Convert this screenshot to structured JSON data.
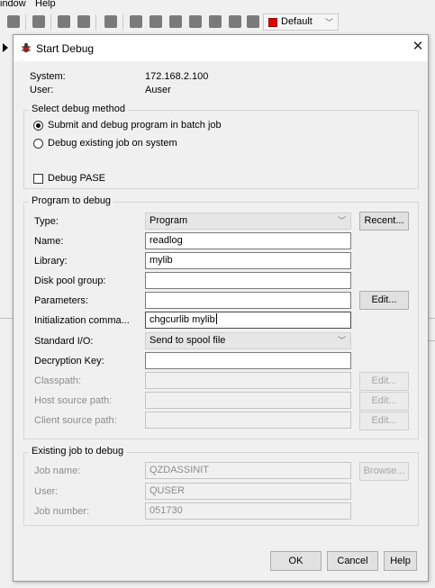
{
  "app": {
    "menu": [
      "indow",
      "Help"
    ],
    "toolbar_combo": "Default"
  },
  "dialog": {
    "title": "Start Debug",
    "close_glyph": "✕",
    "system_label": "System:",
    "system_value": "172.168.2.100",
    "user_label": "User:",
    "user_value": "Auser",
    "method_group": {
      "title": "Select debug method",
      "option_batch": "Submit and debug program in batch job",
      "option_existing": "Debug existing job on system",
      "pase_label": "Debug PASE",
      "selected": "batch",
      "pase_checked": false
    },
    "program_group": {
      "title": "Program to debug",
      "type_label": "Type:",
      "type_value": "Program",
      "recent_button": "Recent...",
      "name_label": "Name:",
      "name_value": "readlog",
      "library_label": "Library:",
      "library_value": "mylib",
      "disk_pool_label": "Disk pool group:",
      "disk_pool_value": "",
      "parameters_label": "Parameters:",
      "parameters_value": "",
      "edit_button": "Edit...",
      "init_cmd_label": "Initialization comma...",
      "init_cmd_value": "chgcurlib mylib",
      "stdio_label": "Standard I/O:",
      "stdio_value": "Send to spool file",
      "decryption_label": "Decryption Key:",
      "decryption_value": "",
      "classpath_label": "Classpath:",
      "host_source_label": "Host source path:",
      "client_source_label": "Client source path:"
    },
    "existing_group": {
      "title": "Existing job to debug",
      "job_name_label": "Job name:",
      "job_name_value": "QZDASSINIT",
      "browse_button": "Browse...",
      "user_label": "User:",
      "user_value": "QUSER",
      "job_number_label": "Job number:",
      "job_number_value": "051730"
    },
    "buttons": {
      "ok": "OK",
      "cancel": "Cancel",
      "help": "Help"
    }
  }
}
